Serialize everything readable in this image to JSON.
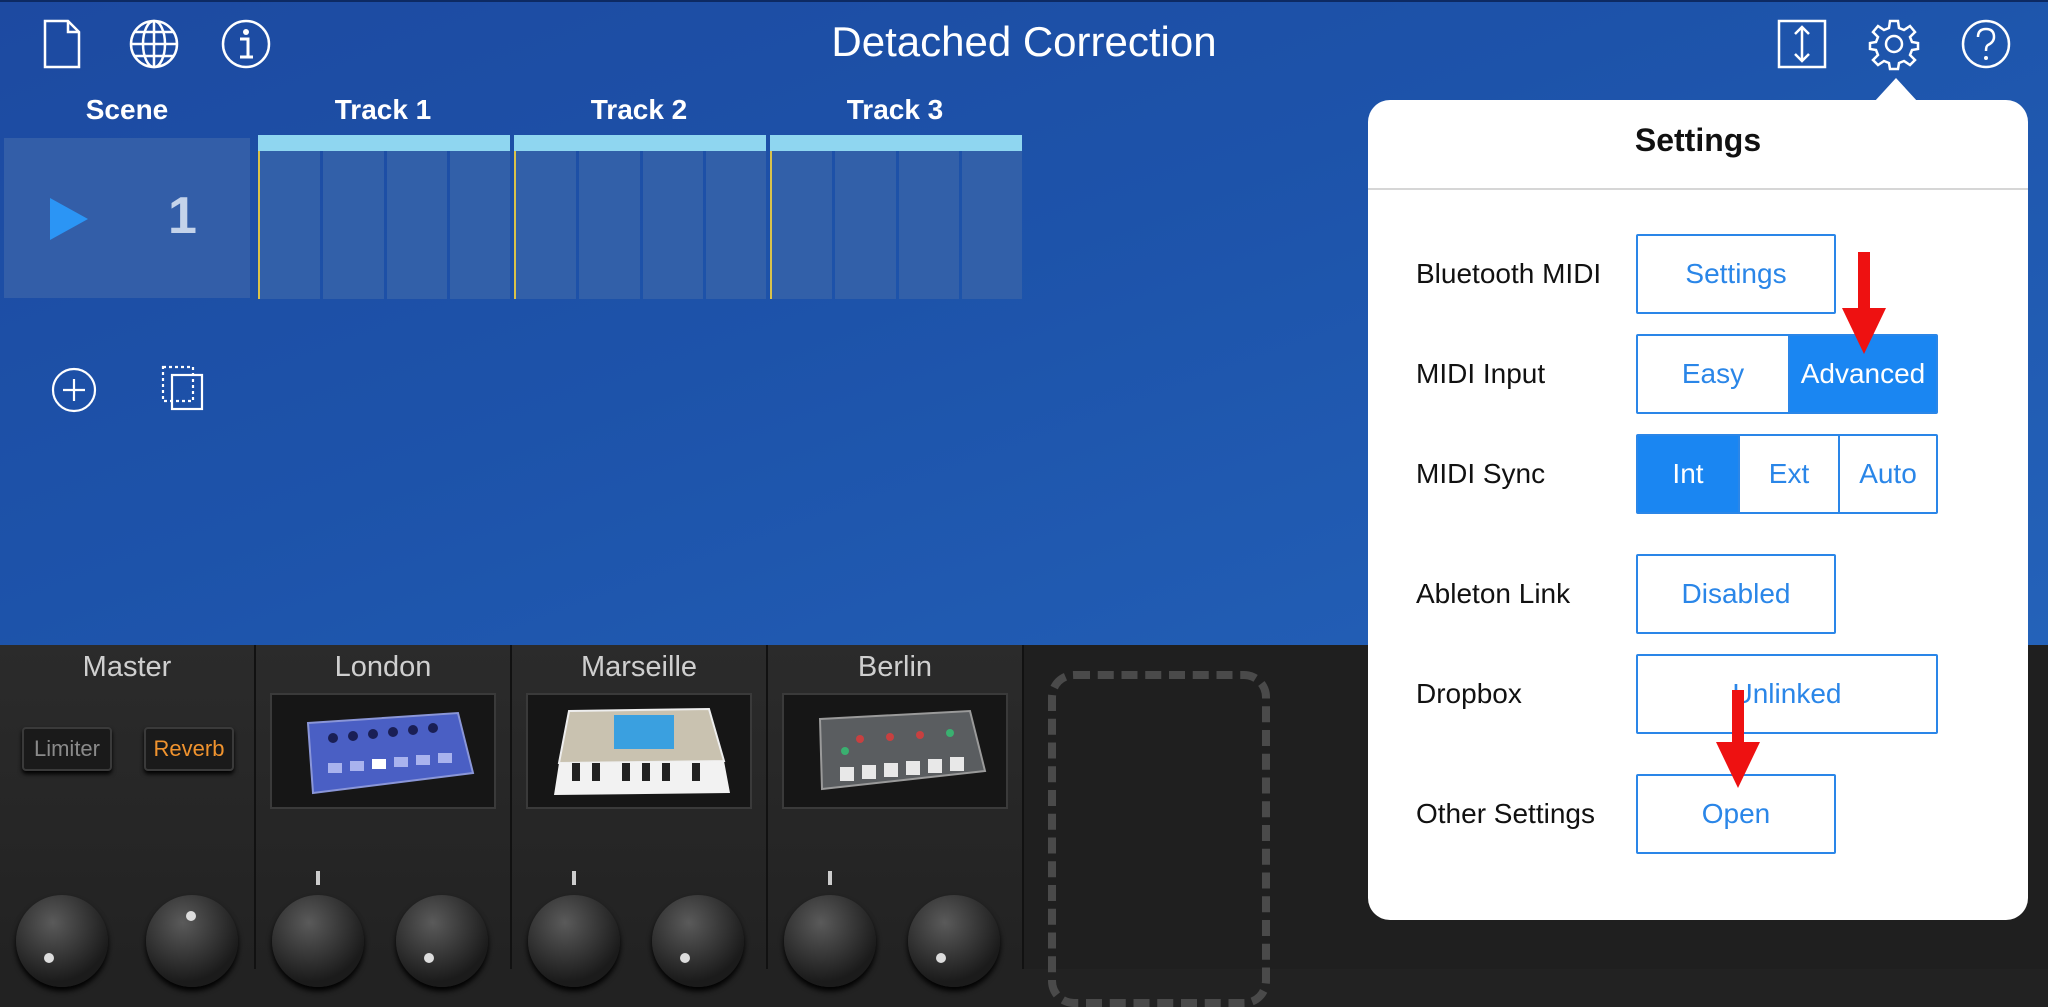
{
  "app": {
    "title": "Detached Correction"
  },
  "toolbar": {
    "left_icons": [
      "document-icon",
      "globe-icon",
      "info-icon"
    ],
    "right_icons": [
      "resize-icon",
      "gear-icon",
      "help-icon"
    ]
  },
  "grid": {
    "scene_header": "Scene",
    "tracks": [
      "Track 1",
      "Track 2",
      "Track 3"
    ],
    "scene_number": "1"
  },
  "mixer": {
    "master": {
      "name": "Master",
      "limiter": "Limiter",
      "reverb": "Reverb"
    },
    "channels": [
      "London",
      "Marseille",
      "Berlin"
    ]
  },
  "settings": {
    "title": "Settings",
    "bluetooth_midi": {
      "label": "Bluetooth MIDI",
      "button": "Settings"
    },
    "midi_input": {
      "label": "MIDI Input",
      "options": [
        "Easy",
        "Advanced"
      ],
      "selected": "Advanced"
    },
    "midi_sync": {
      "label": "MIDI Sync",
      "options": [
        "Int",
        "Ext",
        "Auto"
      ],
      "selected": "Int"
    },
    "ableton_link": {
      "label": "Ableton Link",
      "button": "Disabled"
    },
    "dropbox": {
      "label": "Dropbox",
      "button": "Unlinked"
    },
    "other_settings": {
      "label": "Other Settings",
      "button": "Open"
    }
  },
  "colors": {
    "accent": "#1a86f2",
    "background": "#1d4fa6",
    "annotation_arrow": "#ee1111"
  }
}
